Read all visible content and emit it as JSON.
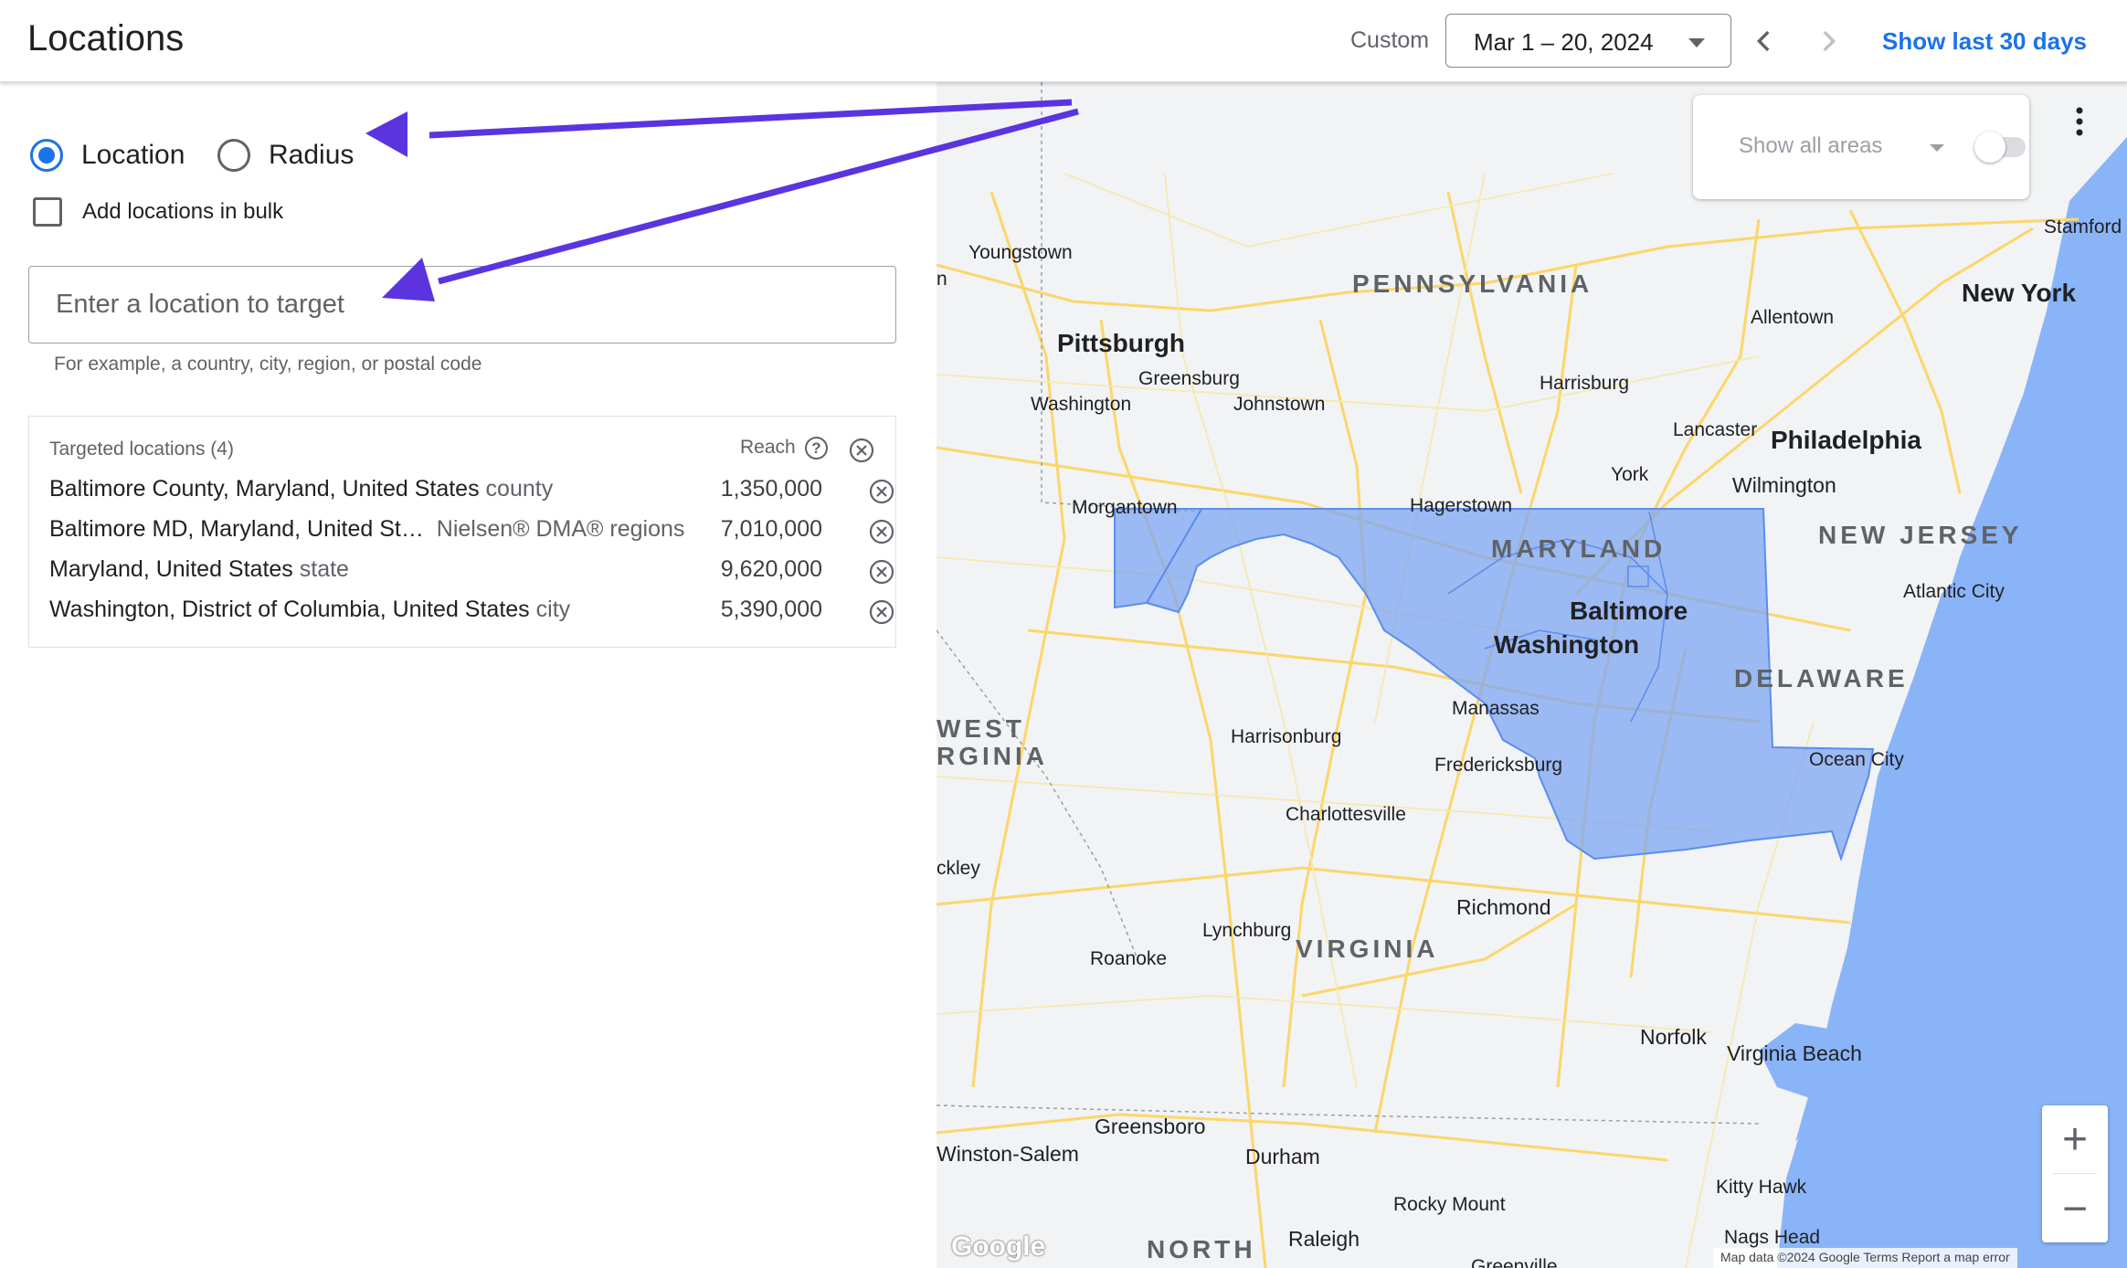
{
  "header": {
    "title": "Locations",
    "custom_label": "Custom",
    "date_range": "Mar 1 – 20, 2024",
    "show_last": "Show last 30 days"
  },
  "targeting": {
    "mode_location": "Location",
    "mode_radius": "Radius",
    "selected_mode": "Location",
    "bulk_label": "Add locations in bulk",
    "input_placeholder": "Enter a location to target",
    "input_value": "",
    "hint": "For example, a country, city, region, or postal code"
  },
  "targeted": {
    "header": "Targeted locations (4)",
    "reach_label": "Reach",
    "rows": [
      {
        "name": "Baltimore County, Maryland, United States",
        "type": "county",
        "reach": "1,350,000"
      },
      {
        "name": "Baltimore MD, Maryland, United St…",
        "type": "Nielsen® DMA® regions",
        "reach": "7,010,000"
      },
      {
        "name": "Maryland, United States",
        "type": "state",
        "reach": "9,620,000"
      },
      {
        "name": "Washington, District of Columbia, United States",
        "type": "city",
        "reach": "5,390,000"
      }
    ]
  },
  "map": {
    "show_areas": "Show all areas",
    "zoom_in": "+",
    "zoom_out": "−",
    "attribution": "Map data ©2024 Google   Terms   Report a map error",
    "logo": "Google",
    "highlight_color": "#7ea6f2",
    "water_color": "#8ab4f8",
    "states": [
      "PENNSYLVANIA",
      "MARYLAND",
      "NEW JERSEY",
      "DELAWARE",
      "VIRGINIA",
      "WEST",
      "RGINIA",
      "NORTH"
    ],
    "big_cities": [
      "Pittsburgh",
      "Philadelphia",
      "New York",
      "Baltimore",
      "Washington",
      "Richmond"
    ],
    "cities": [
      "Youngstown",
      "Greensburg",
      "Washington",
      "Johnstown",
      "Harrisburg",
      "Allentown",
      "Lancaster",
      "York",
      "Wilmington",
      "Morgantown",
      "Hagerstown",
      "Atlantic City",
      "Manassas",
      "Harrisonburg",
      "Fredericksburg",
      "Ocean City",
      "Charlottesville",
      "Lynchburg",
      "Roanoke",
      "Norfolk",
      "Virginia Beach",
      "Winston-Salem",
      "Greensboro",
      "Durham",
      "Raleigh",
      "Rocky Mount",
      "Kitty Hawk",
      "Nags Head",
      "Stamford",
      "ckley",
      "n",
      "Greenville"
    ]
  },
  "colors": {
    "accent": "#1a73e8",
    "arrow": "#5b34e0"
  }
}
